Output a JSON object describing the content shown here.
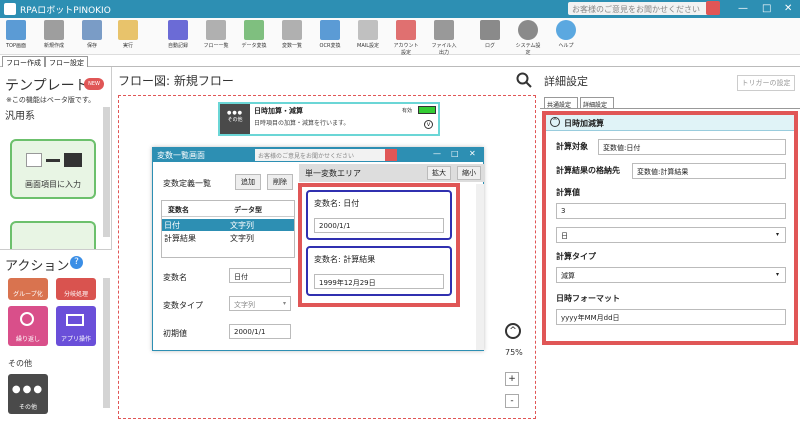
{
  "window": {
    "title": "RPAロボットPINOKIO",
    "feedback": "お客様のご意見をお聞かせください"
  },
  "toolbar": {
    "items": [
      {
        "label": "TOP画面",
        "icon": "home-icon",
        "color": "#5b9bd5"
      },
      {
        "label": "新規作成",
        "icon": "new-file-icon",
        "color": "#9e9e9e"
      },
      {
        "label": "保存",
        "icon": "save-icon",
        "color": "#7a9cc6"
      },
      {
        "label": "実行",
        "icon": "run-icon",
        "color": "#e8c36b"
      },
      {
        "label": "自動記録",
        "icon": "record-icon",
        "color": "#6b6bd6"
      },
      {
        "label": "フロー一覧",
        "icon": "flow-list-icon",
        "color": "#b0b0b0"
      },
      {
        "label": "データ変換",
        "icon": "data-convert-icon",
        "color": "#7fbf7f"
      },
      {
        "label": "変数一覧",
        "icon": "variable-list-icon",
        "color": "#b0b0b0"
      },
      {
        "label": "OCR変換",
        "icon": "ocr-icon",
        "color": "#5b9bd5"
      },
      {
        "label": "MAIL設定",
        "icon": "mail-icon",
        "color": "#c0c0c0"
      },
      {
        "label": "アカウント設定",
        "icon": "account-icon",
        "color": "#e07070"
      },
      {
        "label": "ファイル入出力",
        "icon": "file-io-icon",
        "color": "#999999"
      },
      {
        "label": "ログ",
        "icon": "log-icon",
        "color": "#8a8a8a"
      },
      {
        "label": "システム設定",
        "icon": "gear-icon",
        "color": "#8a8a8a"
      },
      {
        "label": "ヘルプ",
        "icon": "help-icon",
        "color": "#5ba8e0"
      }
    ]
  },
  "tabs": {
    "flow_create": "フロー作成",
    "flow_settings": "フロー設定"
  },
  "left": {
    "template_title": "テンプレート",
    "new_badge": "NEW",
    "beta_note": "※この機能はベータ版です。",
    "category": "汎用系",
    "card1": {
      "label": "画面項目に入力"
    },
    "action_title": "アクション",
    "actions": [
      {
        "label": "グループ化",
        "color": "#d9734f"
      },
      {
        "label": "分岐処理",
        "color": "#d9534f"
      },
      {
        "label": "繰り返し",
        "color": "#d94f8a"
      },
      {
        "label": "アプリ操作",
        "color": "#6a4fd9"
      }
    ],
    "other_title": "その他",
    "other": {
      "label": "その他"
    }
  },
  "canvas": {
    "header": "フロー図:  新規フロー",
    "zoom": "75%"
  },
  "node": {
    "title": "日時加算・減算",
    "desc": "日時項目の加算・減算を行います。",
    "status": "有効",
    "side_label": "その他"
  },
  "dialog": {
    "title": "変数一覧画面",
    "feedback": "お客様のご意見をお聞かせください",
    "def_list": "変数定義一覧",
    "add": "追加",
    "delete": "削除",
    "col_name": "変数名",
    "col_type": "データ型",
    "rows": [
      {
        "name": "日付",
        "type": "文字列"
      },
      {
        "name": "計算結果",
        "type": "文字列"
      }
    ],
    "lbl_varname": "変数名",
    "val_varname": "日付",
    "lbl_vartype": "変数タイプ",
    "val_vartype": "文字列",
    "lbl_init": "初期値",
    "val_init": "2000/1/1",
    "single_area": "単一変数エリア",
    "expand": "拡大",
    "shrink": "縮小",
    "var1": {
      "label": "変数名:  日付",
      "value": "2000/1/1"
    },
    "var2": {
      "label": "変数名:  計算結果",
      "value": "1999年12月29日"
    }
  },
  "right": {
    "title": "詳細設定",
    "trigger": "トリガーの設定",
    "tab_common": "共通設定",
    "tab_detail": "詳細設定",
    "section": "日時加減算",
    "calc_target_label": "計算対象",
    "calc_target": "変数値:日付",
    "store_label": "計算結果の格納先",
    "store": "変数値:計算結果",
    "calc_value_label": "計算値",
    "calc_value": "3",
    "unit": "日",
    "calc_type_label": "計算タイプ",
    "calc_type": "減算",
    "format_label": "日時フォーマット",
    "format": "yyyy年MM月dd日"
  }
}
